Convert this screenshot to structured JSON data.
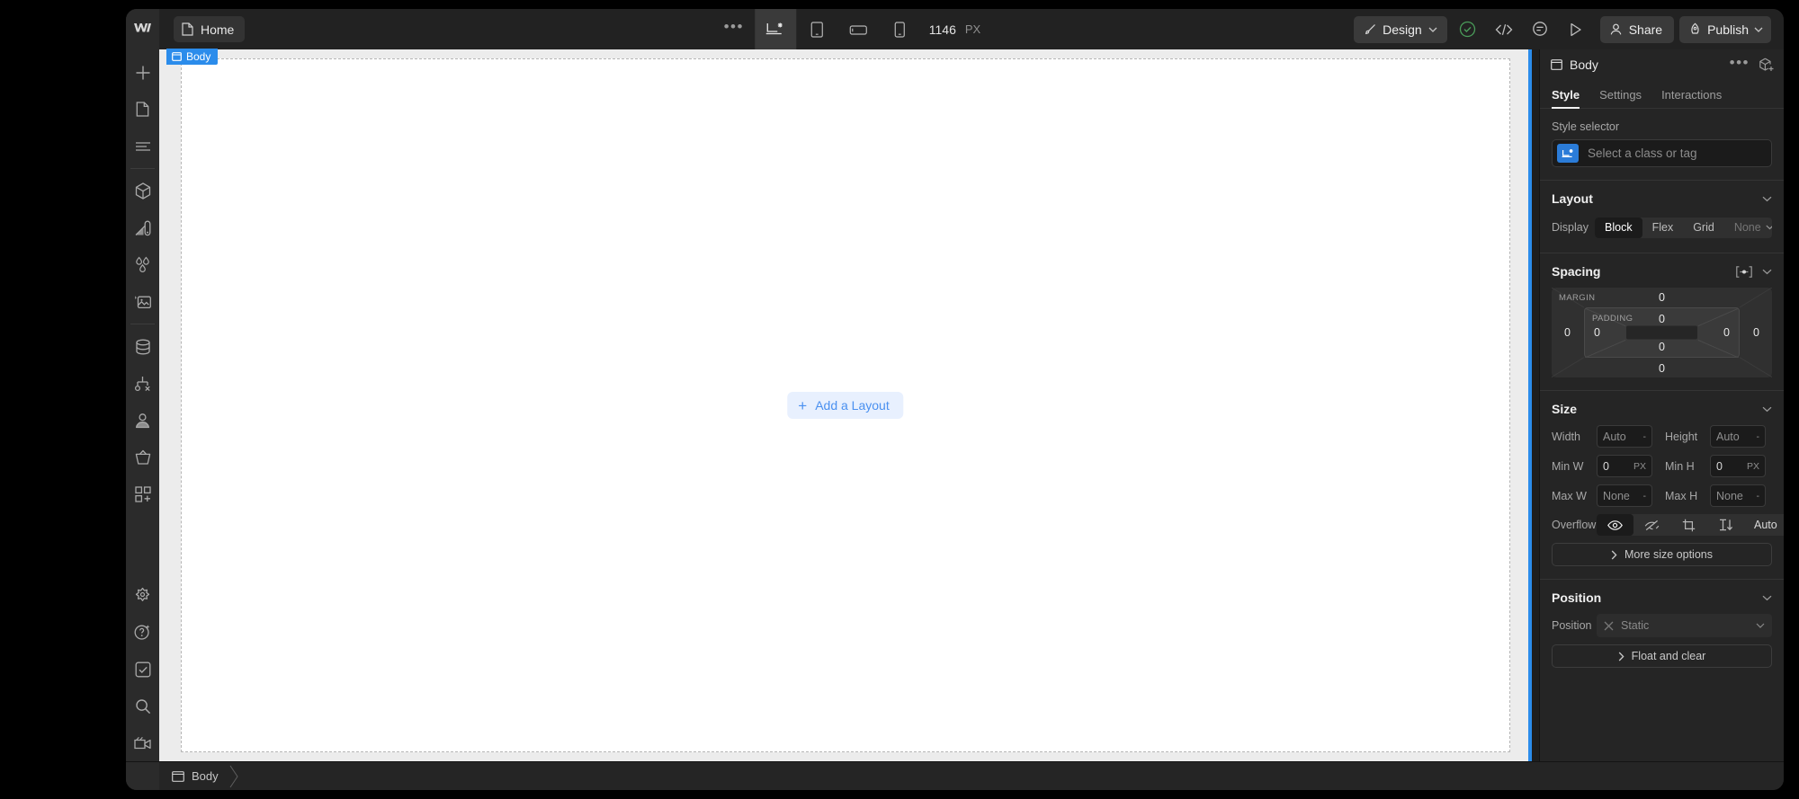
{
  "topbar": {
    "logo_icon": "webflow-logo-icon",
    "page_chip": {
      "icon": "page-icon",
      "label": "Home"
    },
    "overflow_dots": "•••",
    "devices": [
      {
        "name": "desktop",
        "icon": "desktop-breakpoint-icon",
        "active": true
      },
      {
        "name": "tablet",
        "icon": "tablet-icon",
        "active": false
      },
      {
        "name": "mobile-landscape",
        "icon": "mobile-landscape-icon",
        "active": false
      },
      {
        "name": "mobile-portrait",
        "icon": "mobile-portrait-icon",
        "active": false
      }
    ],
    "viewport_width": "1146",
    "viewport_unit": "PX",
    "design_label": "Design",
    "design_icon": "paintbrush-icon",
    "right_icons": [
      {
        "name": "audit-check-icon"
      },
      {
        "name": "code-export-icon"
      },
      {
        "name": "comments-icon"
      },
      {
        "name": "preview-play-icon"
      }
    ],
    "share_label": "Share",
    "share_icon": "person-icon",
    "publish_label": "Publish",
    "publish_icon": "rocket-icon"
  },
  "rail": {
    "items": [
      {
        "name": "add-elements",
        "icon": "plus-icon"
      },
      {
        "name": "pages",
        "icon": "page-icon"
      },
      {
        "name": "navigator",
        "icon": "navigator-lines-icon"
      },
      {
        "name": "components",
        "icon": "cube-icon"
      },
      {
        "name": "style-manager",
        "icon": "style-paint-icon"
      },
      {
        "name": "variables",
        "icon": "water-drops-icon"
      },
      {
        "name": "assets",
        "icon": "image-icon"
      },
      {
        "name": "cms",
        "icon": "database-icon"
      },
      {
        "name": "logic",
        "icon": "logic-flow-icon"
      },
      {
        "name": "users",
        "icon": "user-icon"
      },
      {
        "name": "ecommerce",
        "icon": "shopping-basket-icon"
      },
      {
        "name": "apps",
        "icon": "apps-grid-plus-icon"
      }
    ],
    "bottom_items": [
      {
        "name": "settings",
        "icon": "gear-icon"
      },
      {
        "name": "ai-help",
        "icon": "question-sparkle-icon"
      },
      {
        "name": "audit",
        "icon": "checkbox-icon"
      },
      {
        "name": "search",
        "icon": "search-icon"
      },
      {
        "name": "video",
        "icon": "video-camera-icon"
      }
    ]
  },
  "canvas": {
    "body_badge": {
      "icon": "body-box-icon",
      "label": "Body"
    },
    "add_layout": {
      "icon": "plus-icon",
      "label": "Add a Layout"
    }
  },
  "right_panel": {
    "header": {
      "icon": "body-box-icon",
      "title": "Body",
      "dots": "•••",
      "component_icon": "create-component-icon"
    },
    "tabs": [
      {
        "label": "Style",
        "active": true
      },
      {
        "label": "Settings",
        "active": false
      },
      {
        "label": "Interactions",
        "active": false
      }
    ],
    "style_selector": {
      "label": "Style selector",
      "tag_icon": "breakpoint-tag-icon",
      "placeholder": "Select a class or tag"
    },
    "layout": {
      "title": "Layout",
      "display_label": "Display",
      "options": [
        {
          "label": "Block",
          "active": true
        },
        {
          "label": "Flex",
          "active": false
        },
        {
          "label": "Grid",
          "active": false
        },
        {
          "label": "None",
          "active": false,
          "muted": true
        }
      ]
    },
    "spacing": {
      "title": "Spacing",
      "margin_label": "MARGIN",
      "padding_label": "PADDING",
      "margin": {
        "top": "0",
        "right": "0",
        "bottom": "0",
        "left": "0"
      },
      "padding": {
        "top": "0",
        "right": "0",
        "bottom": "0",
        "left": "0"
      },
      "mode_icon": "spacing-mode-icon"
    },
    "size": {
      "title": "Size",
      "width_label": "Width",
      "width_value": "Auto",
      "width_unit": "-",
      "height_label": "Height",
      "height_value": "Auto",
      "height_unit": "-",
      "minw_label": "Min W",
      "minw_value": "0",
      "minw_unit": "PX",
      "minh_label": "Min H",
      "minh_value": "0",
      "minh_unit": "PX",
      "maxw_label": "Max W",
      "maxw_value": "None",
      "maxw_unit": "-",
      "maxh_label": "Max H",
      "maxh_value": "None",
      "maxh_unit": "-",
      "overflow_label": "Overflow",
      "overflow_options": [
        {
          "name": "visible",
          "icon": "eye-icon",
          "active": true
        },
        {
          "name": "hidden",
          "icon": "eye-off-icon",
          "active": false
        },
        {
          "name": "scroll",
          "icon": "crop-scroll-icon",
          "active": false
        },
        {
          "name": "auto-scroll",
          "icon": "scroll-down-icon",
          "active": false
        }
      ],
      "overflow_auto_label": "Auto",
      "more_options_label": "More size options",
      "more_options_icon": "chevron-right-icon"
    },
    "position": {
      "title": "Position",
      "field_label": "Position",
      "value": "Static",
      "clear_icon": "close-x-icon",
      "float_label": "Float and clear",
      "float_icon": "chevron-right-icon"
    }
  },
  "bottom_bar": {
    "crumb": {
      "icon": "body-box-icon",
      "label": "Body"
    }
  }
}
